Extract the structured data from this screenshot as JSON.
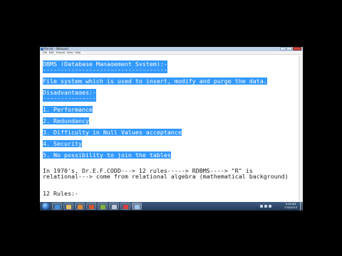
{
  "window": {
    "title": "file.txt - Notepad",
    "menu": [
      "File",
      "Edit",
      "Format",
      "View",
      "Help"
    ]
  },
  "editor": {
    "lines": [
      {
        "text": "DBMS (Database Management System):-",
        "selected": true
      },
      {
        "text": "-----------------------------------",
        "selected": true
      },
      {
        "text": "File system which is used to insert, modify and purge the data.",
        "selected": true
      },
      {
        "text": "Disadvantages:-",
        "selected": true
      },
      {
        "text": "---------------",
        "selected": true
      },
      {
        "text": "1. Performance",
        "selected": true
      },
      {
        "text": "2. Redundancy",
        "selected": true
      },
      {
        "text": "3. Difficulty in Null Values acceptance",
        "selected": true
      },
      {
        "text": "4. Security",
        "selected": true
      },
      {
        "text": "5. No possibility to join the tables",
        "selected": true
      },
      {
        "text": "In 1970's, Dr.E.F.CODD---> 12 rules-----> RDBMS----> \"R\" is",
        "selected": false
      },
      {
        "text": "relational---> come from relational algebra (mathematical background)",
        "selected": false
      },
      {
        "text": "12 Rules:-",
        "selected": false
      }
    ]
  },
  "taskbar": {
    "clock_time": "9:46 AM",
    "clock_date": "7/30/2013"
  },
  "colors": {
    "selection": "#3399ff",
    "taskbar": "#2d4a6e"
  }
}
